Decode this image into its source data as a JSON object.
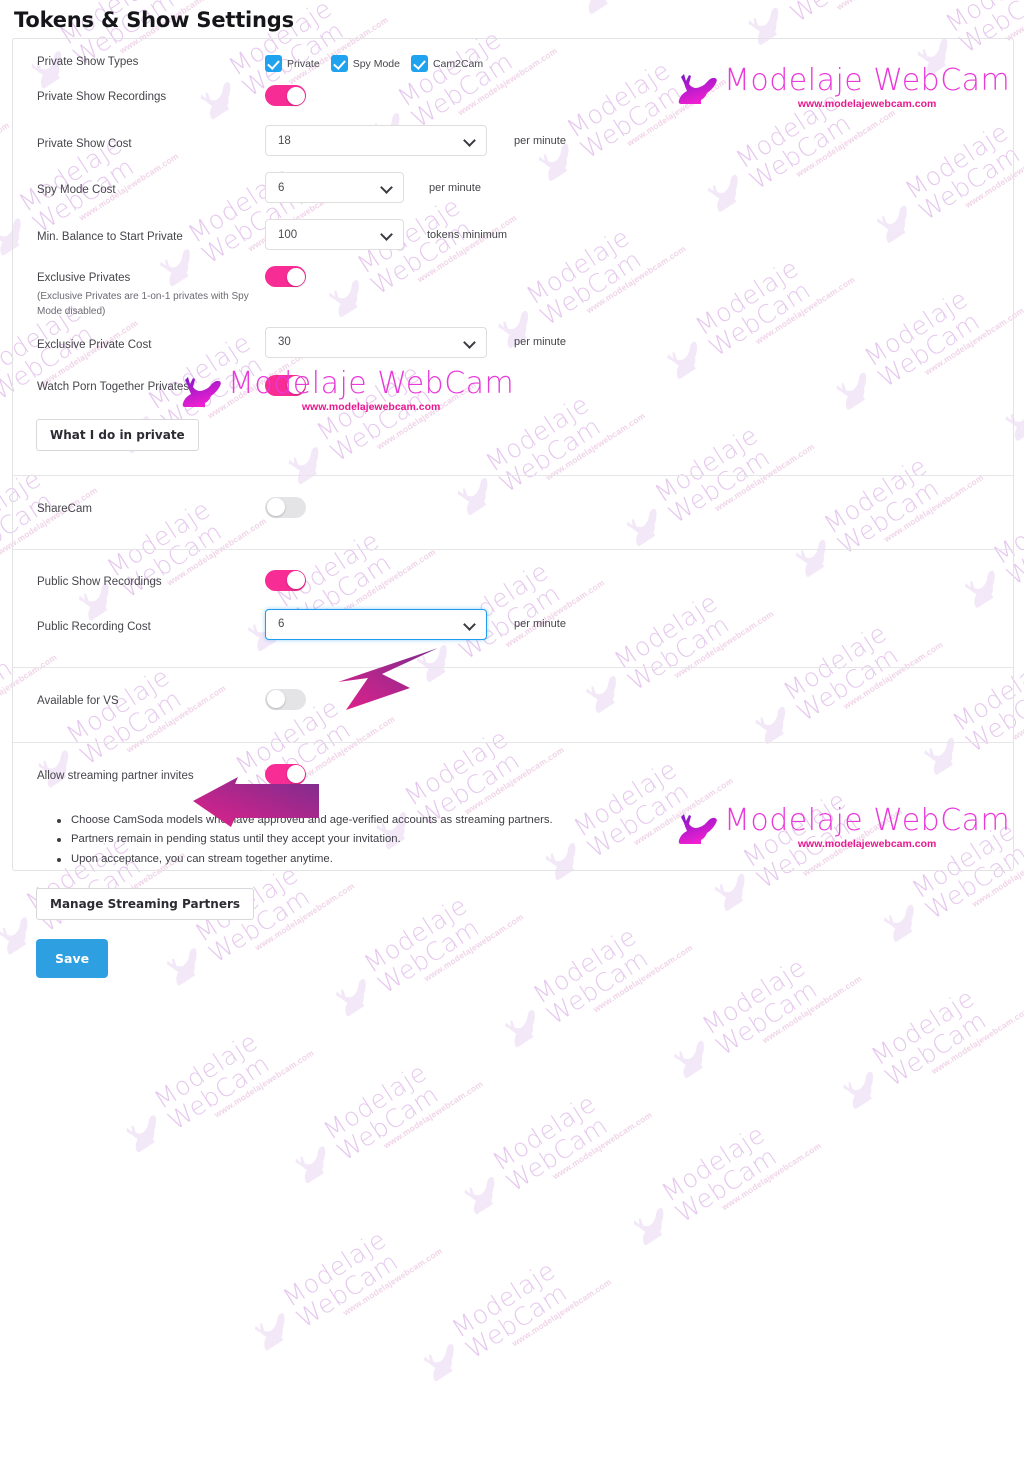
{
  "page": {
    "title": "Tokens & Show Settings"
  },
  "colors": {
    "toggle_on": "#f72c95",
    "toggle_off": "#e4e4e7",
    "checkbox": "#20a3ef",
    "primary_button": "#2e9fe0",
    "focus_border": "#1f9cf0",
    "arrow_start": "#7b2d8e",
    "arrow_end": "#e0218a",
    "brand_pink": "#e839d9"
  },
  "brand": {
    "name": "Modelaje WebCam",
    "url": "www.modelajewebcam.com",
    "figure_icon": "reclining-woman-silhouette-icon"
  },
  "sections": [
    {
      "id": "private-shows",
      "rows": [
        {
          "id": "private-show-types",
          "label": "Private Show Types",
          "control": "checkbox-group",
          "checkboxes": [
            {
              "label": "Private",
              "checked": true
            },
            {
              "label": "Spy Mode",
              "checked": true
            },
            {
              "label": "Cam2Cam",
              "checked": true
            }
          ]
        },
        {
          "id": "private-show-recordings",
          "label": "Private Show Recordings",
          "control": "toggle",
          "state": "on"
        },
        {
          "id": "private-show-cost",
          "label": "Private Show Cost",
          "control": "select",
          "value": "18",
          "suffix": "per minute",
          "width": "wide",
          "focused": false
        },
        {
          "id": "spy-mode-cost",
          "label": "Spy Mode Cost",
          "control": "select",
          "value": "6",
          "suffix": "per minute",
          "width": "narrow",
          "focused": false
        },
        {
          "id": "min-balance-to-start-private",
          "label": "Min. Balance to Start Private",
          "control": "select",
          "value": "100",
          "suffix": "tokens minimum",
          "width": "narrow",
          "focused": false
        },
        {
          "id": "exclusive-privates",
          "label": "Exclusive Privates",
          "sublabel": "(Exclusive Privates are 1-on-1 privates with Spy Mode disabled)",
          "control": "toggle",
          "state": "on"
        },
        {
          "id": "exclusive-private-cost",
          "label": "Exclusive Private Cost",
          "control": "select",
          "value": "30",
          "suffix": "per minute",
          "width": "wide",
          "focused": false
        },
        {
          "id": "watch-porn-together-privates",
          "label": "Watch Porn Together Privates",
          "control": "toggle",
          "state": "on"
        }
      ],
      "button": {
        "id": "what-i-do-in-private",
        "label": "What I do in private"
      }
    },
    {
      "id": "sharecam",
      "rows": [
        {
          "id": "sharecam",
          "label": "ShareCam",
          "control": "toggle",
          "state": "off"
        }
      ]
    },
    {
      "id": "public-shows",
      "rows": [
        {
          "id": "public-show-recordings",
          "label": "Public Show Recordings",
          "control": "toggle",
          "state": "on"
        },
        {
          "id": "public-recording-cost",
          "label": "Public Recording Cost",
          "control": "select",
          "value": "6",
          "suffix": "per minute",
          "width": "wide",
          "focused": true
        }
      ]
    },
    {
      "id": "available-for-vs",
      "rows": [
        {
          "id": "available-for-vs",
          "label": "Available for VS",
          "control": "toggle",
          "state": "off"
        }
      ]
    },
    {
      "id": "streaming-partners",
      "rows": [
        {
          "id": "allow-streaming-partner-invites",
          "label": "Allow streaming partner invites",
          "control": "toggle",
          "state": "on"
        }
      ],
      "notes": [
        "Choose CamSoda models who have approved and age-verified accounts as streaming partners.",
        "Partners remain in pending status until they accept your invitation.",
        "Upon acceptance, you can stream together anytime."
      ],
      "manage_button": {
        "id": "manage-streaming-partners",
        "label": "Manage Streaming Partners"
      }
    }
  ],
  "save_button": {
    "label": "Save"
  }
}
